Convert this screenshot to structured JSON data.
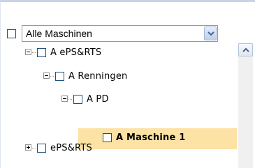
{
  "filter": {
    "checked": false,
    "selected_value": "Alle Maschinen"
  },
  "tree": {
    "items": [
      {
        "label": "A ePS&RTS",
        "expanded": true,
        "checked": false
      },
      {
        "label": "A Renningen",
        "expanded": true,
        "checked": false
      },
      {
        "label": "A PD",
        "expanded": true,
        "checked": false
      },
      {
        "label": "A Maschine 1",
        "selected": true,
        "checked": false
      },
      {
        "label": "ePS&RTS",
        "expanded": false,
        "checked": false
      }
    ]
  },
  "colors": {
    "selection": "#fde2a5",
    "checkbox_border": "#1c5180"
  },
  "icons": [
    "chevron-up-icon",
    "chevron-down-icon",
    "collapse-icon",
    "expand-icon"
  ]
}
